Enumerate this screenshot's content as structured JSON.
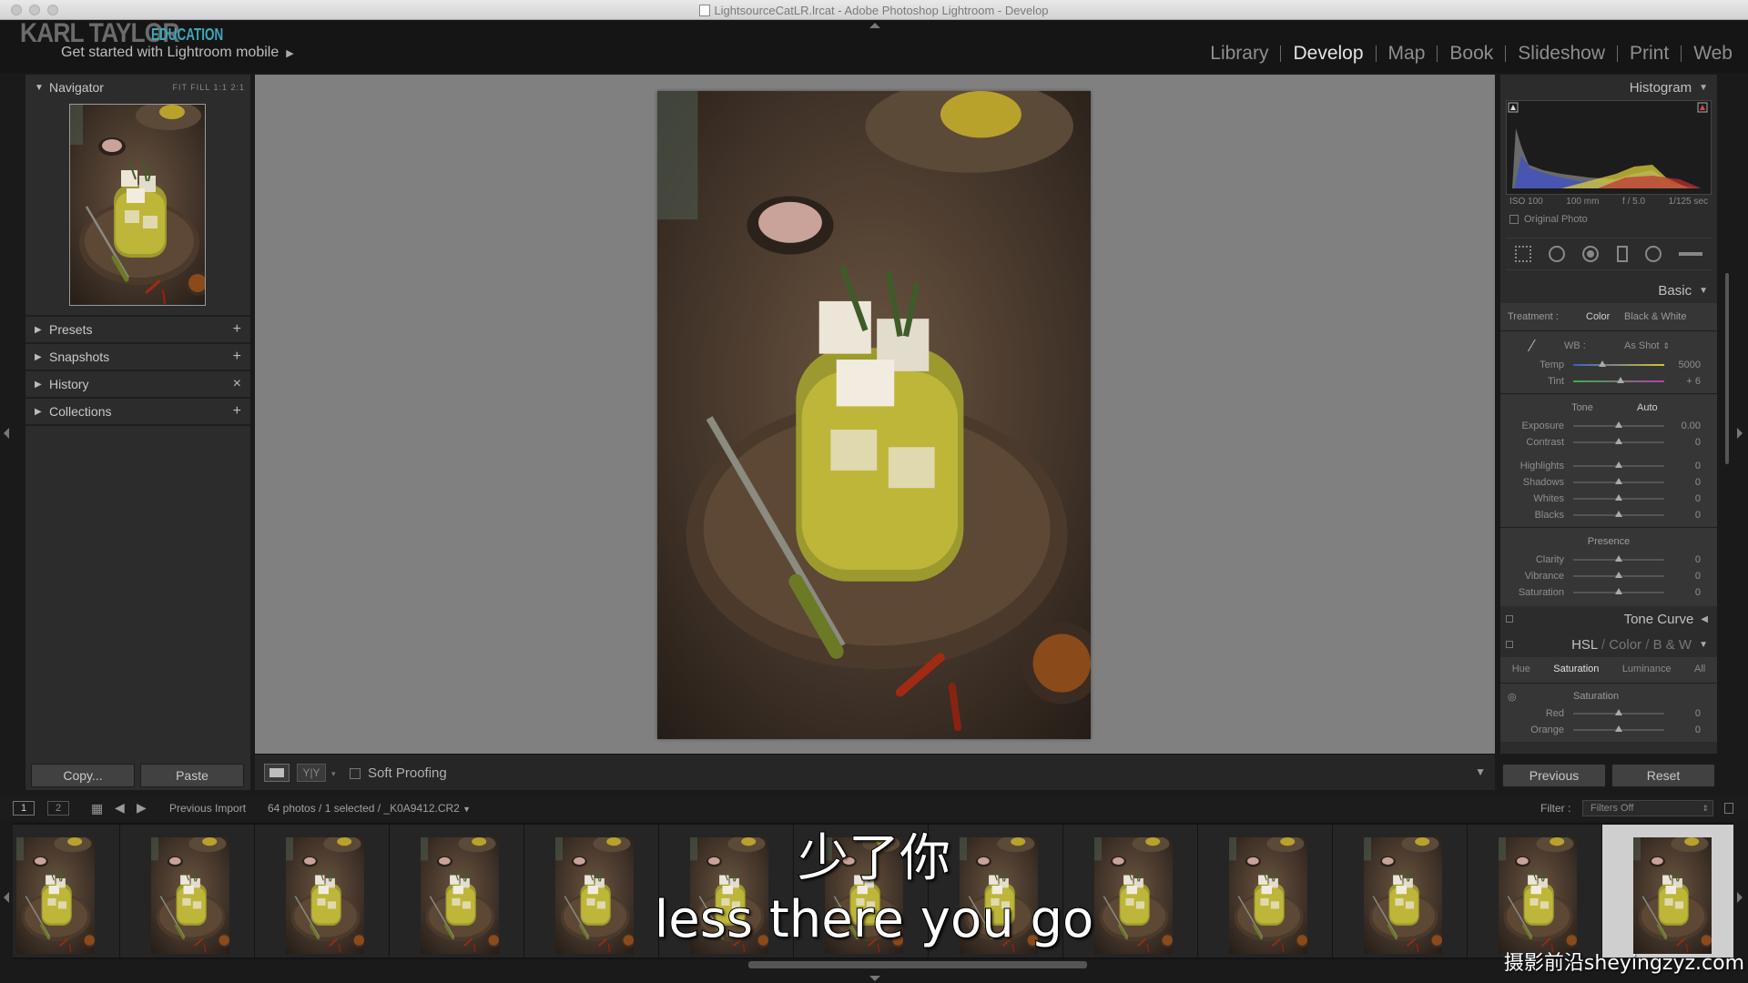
{
  "window": {
    "title": "LightsourceCatLR.lrcat - Adobe Photoshop Lightroom - Develop"
  },
  "identity": {
    "brand": "KARL TAYLOR",
    "brand_sub": "EDUCATION",
    "mobile_prompt": "Get started with Lightroom mobile"
  },
  "modules": [
    "Library",
    "Develop",
    "Map",
    "Book",
    "Slideshow",
    "Print",
    "Web"
  ],
  "active_module": "Develop",
  "left_panel": {
    "navigator": {
      "label": "Navigator",
      "zoom_options": "FIT  FILL  1:1  2:1"
    },
    "sections": [
      {
        "label": "Presets",
        "action": "+"
      },
      {
        "label": "Snapshots",
        "action": "+"
      },
      {
        "label": "History",
        "action": "×"
      },
      {
        "label": "Collections",
        "action": "+"
      }
    ],
    "copy_label": "Copy...",
    "paste_label": "Paste"
  },
  "toolbar": {
    "yy_label": "Y|Y",
    "soft_proofing": "Soft Proofing"
  },
  "right_panel": {
    "histogram": {
      "label": "Histogram",
      "iso": "ISO 100",
      "focal": "100 mm",
      "aperture": "f / 5.0",
      "shutter": "1/125 sec",
      "original_photo": "Original Photo"
    },
    "basic": {
      "label": "Basic",
      "treatment_label": "Treatment :",
      "treatment_color": "Color",
      "treatment_bw": "Black & White",
      "wb_label": "WB :",
      "wb_value": "As Shot",
      "tone_label": "Tone",
      "auto_label": "Auto",
      "presence_label": "Presence",
      "wb_sliders": [
        {
          "name": "Temp",
          "value": "5000",
          "pos": 0.32
        },
        {
          "name": "Tint",
          "value": "+ 6",
          "pos": 0.52
        }
      ],
      "tone_sliders_a": [
        {
          "name": "Exposure",
          "value": "0.00",
          "pos": 0.5
        },
        {
          "name": "Contrast",
          "value": "0",
          "pos": 0.5
        }
      ],
      "tone_sliders_b": [
        {
          "name": "Highlights",
          "value": "0",
          "pos": 0.5
        },
        {
          "name": "Shadows",
          "value": "0",
          "pos": 0.5
        },
        {
          "name": "Whites",
          "value": "0",
          "pos": 0.5
        },
        {
          "name": "Blacks",
          "value": "0",
          "pos": 0.5
        }
      ],
      "presence_sliders": [
        {
          "name": "Clarity",
          "value": "0",
          "pos": 0.5
        },
        {
          "name": "Vibrance",
          "value": "0",
          "pos": 0.5
        },
        {
          "name": "Saturation",
          "value": "0",
          "pos": 0.5
        }
      ]
    },
    "tone_curve": {
      "label": "Tone Curve"
    },
    "hsl": {
      "label_hsl": "HSL",
      "label_color": "Color",
      "label_bw": "B & W",
      "tabs": [
        "Hue",
        "Saturation",
        "Luminance",
        "All"
      ],
      "active_tab": "Saturation",
      "group_label": "Saturation",
      "sliders": [
        {
          "name": "Red",
          "value": "0",
          "pos": 0.5
        },
        {
          "name": "Orange",
          "value": "0",
          "pos": 0.5
        }
      ]
    },
    "previous_label": "Previous",
    "reset_label": "Reset"
  },
  "filmstrip_bar": {
    "screen1": "1",
    "screen2": "2",
    "source": "Previous Import",
    "count": "64 photos / 1 selected /",
    "filename": "_K0A9412.CR2",
    "filter_label": "Filter :",
    "filter_value": "Filters Off"
  },
  "filmstrip": {
    "count": 13,
    "selected_index": 12
  },
  "subtitles": {
    "line1": "少了你",
    "line2": "less there you go"
  },
  "watermark": "摄影前沿sheyingzyz.com",
  "colors": {
    "accent": "#3fa7b8",
    "panel": "#2c2c2c",
    "canvas": "#808080"
  }
}
